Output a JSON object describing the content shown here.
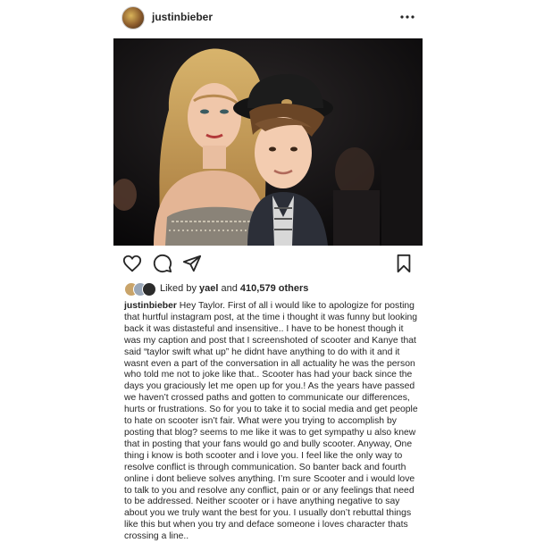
{
  "post": {
    "username": "justinbieber",
    "more_icon": "more-horizontal-icon"
  },
  "photo": {
    "icon": "photo-two-people"
  },
  "actions": {
    "like_icon": "heart-icon",
    "comment_icon": "comment-icon",
    "share_icon": "share-icon",
    "save_icon": "bookmark-icon"
  },
  "likes": {
    "prefix": "Liked by ",
    "user": "yael",
    "middle": " and ",
    "count": "410,579 others"
  },
  "caption": {
    "username": "justinbieber",
    "text": "Hey Taylor. First of all i would like to apologize for posting that hurtful instagram post, at the time i thought it was funny but looking back it was distasteful and insensitive.. I have to be honest though it was my caption and post that I screenshoted of scooter and  Kanye that said “taylor swift what up” he didnt have anything to do with it and it wasnt even a part of the conversation in all actuality he was the person who told me not to joke like that.. Scooter has had your back since the days you graciously let me open up for you.! As the years have passed we haven’t crossed paths and gotten to communicate our differences, hurts or frustrations. So for you to take it to social media and get people to hate on scooter isn’t fair. What were you trying to accomplish by posting that blog? seems to me like it was to get sympathy u also knew that in posting that your fans would go and bully scooter. Anyway, One thing i know is both scooter and i love you. I feel like the only way to resolve conflict is through communication. So banter back and fourth online i dont believe solves anything. I’m sure Scooter and i would love to talk to you and resolve any conflict, pain or or any feelings that need to be addressed. Neither scooter or i  have anything negative to say about you we truly want the best for you. I usually don’t rebuttal things like this but when you try and deface someone i loves character thats crossing a line.."
  }
}
